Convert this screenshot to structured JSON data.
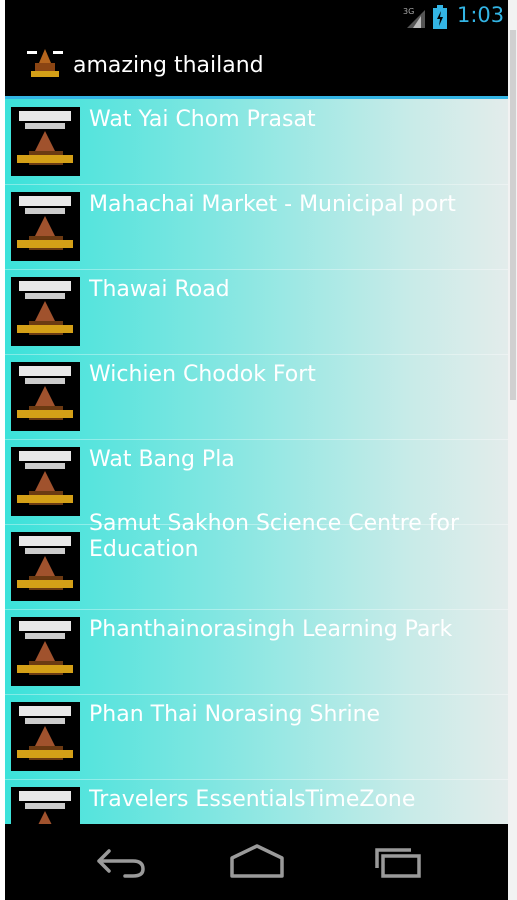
{
  "status_bar": {
    "network": "3G",
    "time": "1:03",
    "accent_color": "#33b5e5"
  },
  "action_bar": {
    "title": "amazing thailand",
    "icon": "app-logo-icon"
  },
  "list": {
    "items": [
      {
        "label": "Wat Yai Chom Prasat",
        "thumb": "place-thumbnail-icon"
      },
      {
        "label": "Mahachai Market - Municipal port",
        "thumb": "place-thumbnail-icon"
      },
      {
        "label": "Thawai Road",
        "thumb": "place-thumbnail-icon"
      },
      {
        "label": "Wichien Chodok Fort",
        "thumb": "place-thumbnail-icon"
      },
      {
        "label": "Wat Bang Pla",
        "thumb": "place-thumbnail-icon"
      },
      {
        "label": "Samut Sakhon Science Centre for Education",
        "thumb": "place-thumbnail-icon"
      },
      {
        "label": "Phanthainorasingh Learning Park",
        "thumb": "place-thumbnail-icon"
      },
      {
        "label": "Phan Thai Norasing Shrine",
        "thumb": "place-thumbnail-icon"
      },
      {
        "label": "Travelers EssentialsTimeZone",
        "thumb": "place-thumbnail-icon"
      }
    ],
    "gradient_start": "#3be2da",
    "gradient_end": "#e3eceb"
  },
  "nav_bar": {
    "buttons": [
      "back-icon",
      "home-icon",
      "recent-apps-icon"
    ]
  }
}
